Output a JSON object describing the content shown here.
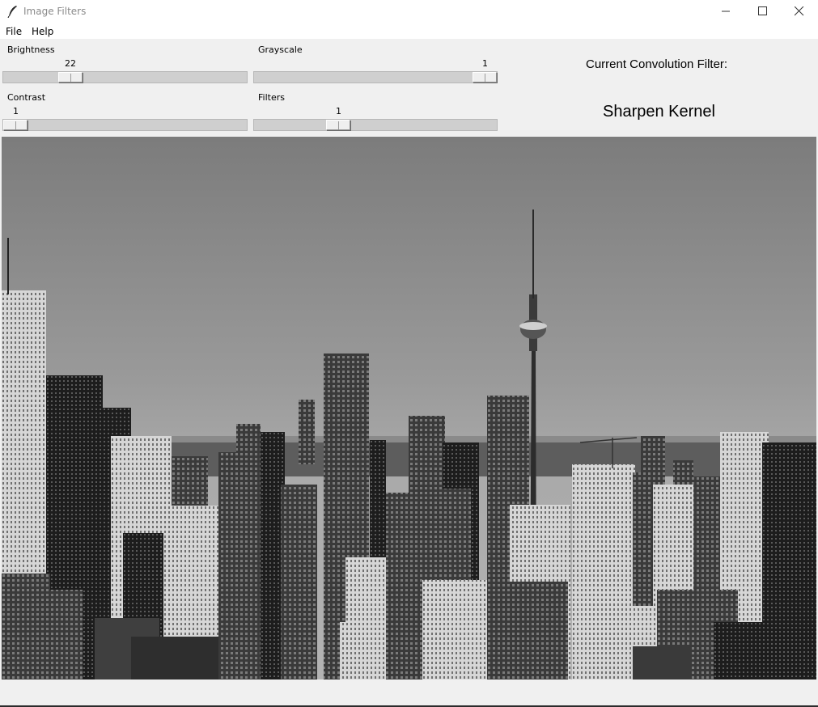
{
  "window": {
    "title": "Image Filters",
    "icon": "feather-icon",
    "controls": [
      "minimize-icon",
      "maximize-icon",
      "close-icon"
    ]
  },
  "menu": {
    "file": "File",
    "help": "Help"
  },
  "sliders": {
    "brightness": {
      "label": "Brightness",
      "value": "22",
      "fraction": 0.25
    },
    "grayscale": {
      "label": "Grayscale",
      "value": "1",
      "fraction": 1.0
    },
    "contrast": {
      "label": "Contrast",
      "value": "1",
      "fraction": 0.0
    },
    "filters": {
      "label": "Filters",
      "value": "1",
      "fraction": 0.33
    }
  },
  "convolution": {
    "caption": "Current Convolution Filter:",
    "name": "Sharpen Kernel"
  },
  "image": {
    "description_icon": "city-skyline-image",
    "mode": "grayscale"
  }
}
